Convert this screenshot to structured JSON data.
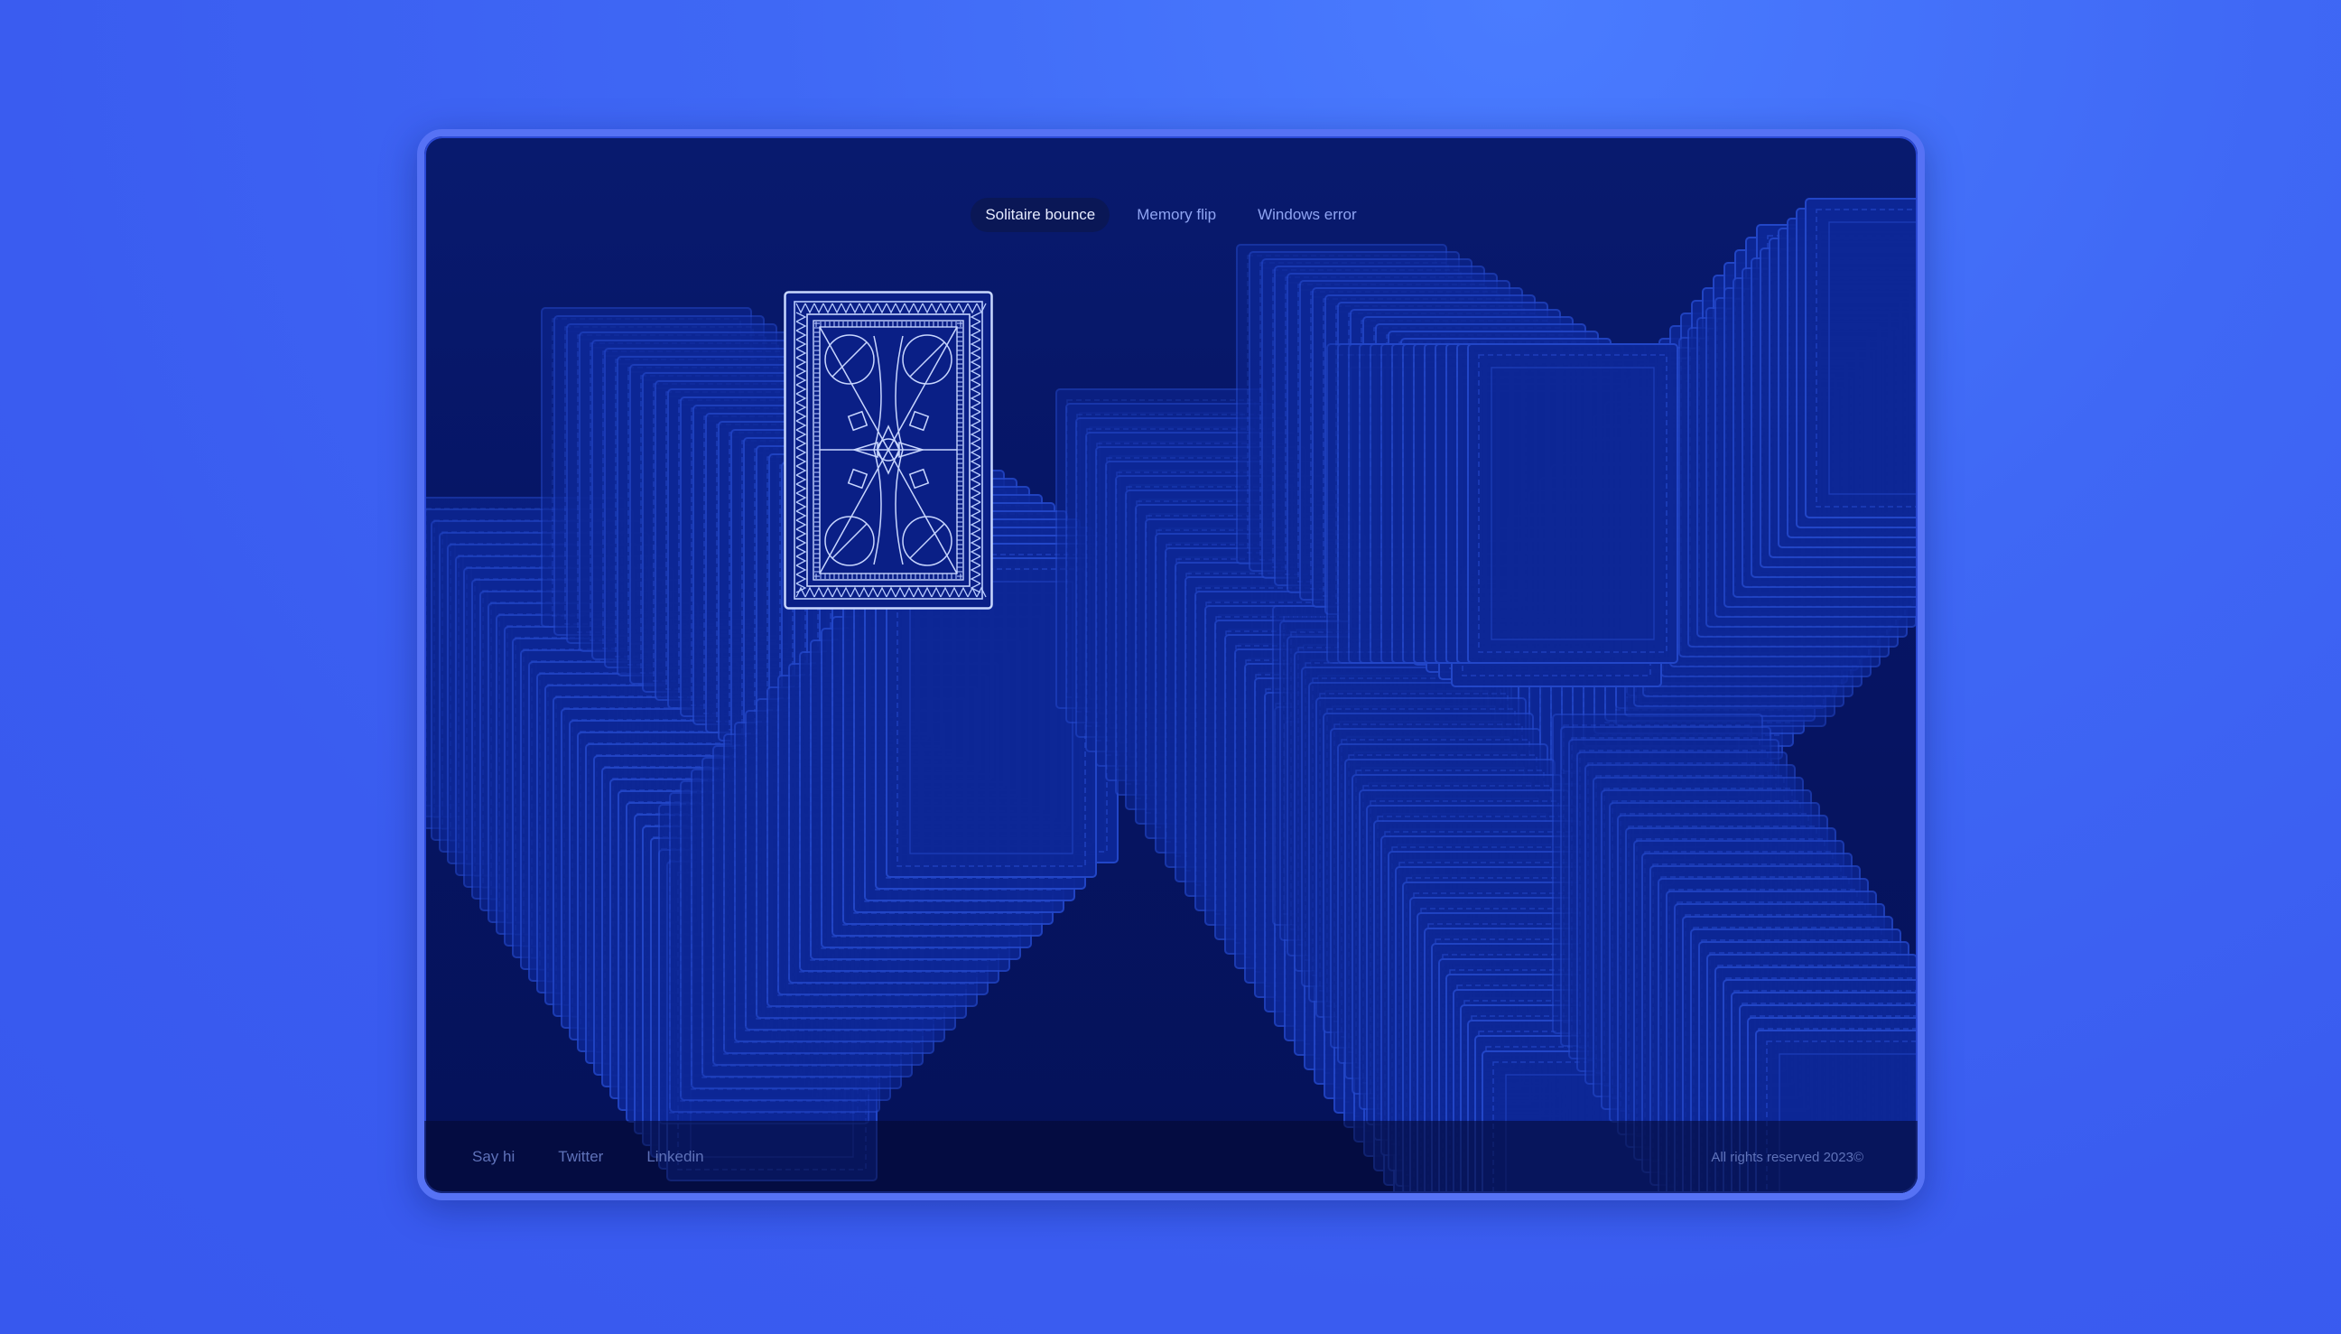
{
  "nav": {
    "items": [
      {
        "label": "Solitaire bounce",
        "active": true
      },
      {
        "label": "Memory flip",
        "active": false
      },
      {
        "label": "Windows error",
        "active": false
      }
    ]
  },
  "footer": {
    "links": [
      "Say hi",
      "Twitter",
      "Linkedin"
    ],
    "copyright": "All rights reserved 2023©"
  },
  "colors": {
    "background": "#3f68f5",
    "window_border": "#5672f5",
    "window_bg": "#061565",
    "card_trail": "#1637b8",
    "card_outline": "#c6d6ff"
  },
  "icons": {
    "card_back": "card-back-icon"
  }
}
